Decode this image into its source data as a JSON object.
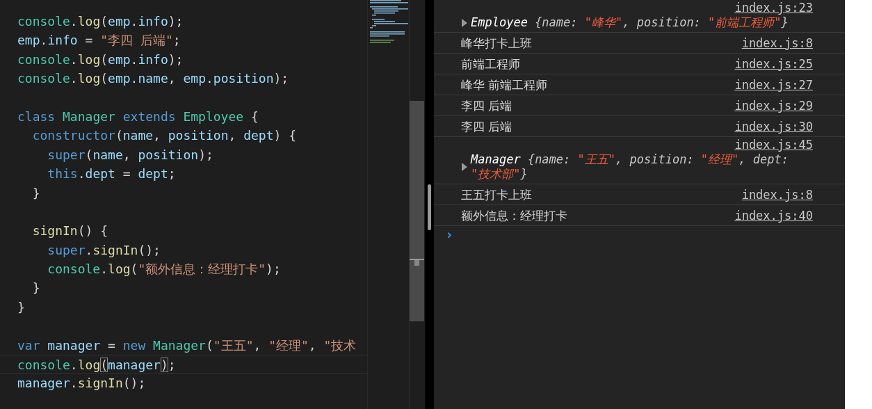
{
  "editor": {
    "lines": [
      {
        "kind": "code",
        "current": false,
        "tokens": [
          {
            "text": "console",
            "kind": "obj"
          },
          {
            "text": ".",
            "kind": "p"
          },
          {
            "text": "log",
            "kind": "fn"
          },
          {
            "text": "(",
            "kind": "p"
          },
          {
            "text": "emp",
            "kind": "var"
          },
          {
            "text": ".",
            "kind": "p"
          },
          {
            "text": "info",
            "kind": "var"
          },
          {
            "text": ");",
            "kind": "p"
          }
        ]
      },
      {
        "kind": "code",
        "current": false,
        "tokens": [
          {
            "text": "emp",
            "kind": "var"
          },
          {
            "text": ".",
            "kind": "p"
          },
          {
            "text": "info",
            "kind": "var"
          },
          {
            "text": " = ",
            "kind": "p"
          },
          {
            "text": "\"李四 后端\"",
            "kind": "str"
          },
          {
            "text": ";",
            "kind": "p"
          }
        ]
      },
      {
        "kind": "code",
        "current": false,
        "tokens": [
          {
            "text": "console",
            "kind": "obj"
          },
          {
            "text": ".",
            "kind": "p"
          },
          {
            "text": "log",
            "kind": "fn"
          },
          {
            "text": "(",
            "kind": "p"
          },
          {
            "text": "emp",
            "kind": "var"
          },
          {
            "text": ".",
            "kind": "p"
          },
          {
            "text": "info",
            "kind": "var"
          },
          {
            "text": ");",
            "kind": "p"
          }
        ]
      },
      {
        "kind": "code",
        "current": false,
        "tokens": [
          {
            "text": "console",
            "kind": "obj"
          },
          {
            "text": ".",
            "kind": "p"
          },
          {
            "text": "log",
            "kind": "fn"
          },
          {
            "text": "(",
            "kind": "p"
          },
          {
            "text": "emp",
            "kind": "var"
          },
          {
            "text": ".",
            "kind": "p"
          },
          {
            "text": "name",
            "kind": "var"
          },
          {
            "text": ", ",
            "kind": "p"
          },
          {
            "text": "emp",
            "kind": "var"
          },
          {
            "text": ".",
            "kind": "p"
          },
          {
            "text": "position",
            "kind": "var"
          },
          {
            "text": ");",
            "kind": "p"
          }
        ]
      },
      {
        "kind": "blank"
      },
      {
        "kind": "code",
        "current": false,
        "tokens": [
          {
            "text": "class ",
            "kind": "kw"
          },
          {
            "text": "Manager ",
            "kind": "obj"
          },
          {
            "text": "extends ",
            "kind": "kw"
          },
          {
            "text": "Employee",
            "kind": "obj"
          },
          {
            "text": " {",
            "kind": "p"
          }
        ]
      },
      {
        "kind": "code",
        "current": false,
        "tokens": [
          {
            "text": "  constructor",
            "kind": "kw"
          },
          {
            "text": "(",
            "kind": "p"
          },
          {
            "text": "name",
            "kind": "var"
          },
          {
            "text": ", ",
            "kind": "p"
          },
          {
            "text": "position",
            "kind": "var"
          },
          {
            "text": ", ",
            "kind": "p"
          },
          {
            "text": "dept",
            "kind": "var"
          },
          {
            "text": ") {",
            "kind": "p"
          }
        ]
      },
      {
        "kind": "code",
        "current": false,
        "tokens": [
          {
            "text": "    super",
            "kind": "kw"
          },
          {
            "text": "(",
            "kind": "p"
          },
          {
            "text": "name",
            "kind": "var"
          },
          {
            "text": ", ",
            "kind": "p"
          },
          {
            "text": "position",
            "kind": "var"
          },
          {
            "text": ");",
            "kind": "p"
          }
        ]
      },
      {
        "kind": "code",
        "current": false,
        "tokens": [
          {
            "text": "    this",
            "kind": "kw"
          },
          {
            "text": ".",
            "kind": "p"
          },
          {
            "text": "dept",
            "kind": "var"
          },
          {
            "text": " = ",
            "kind": "p"
          },
          {
            "text": "dept",
            "kind": "var"
          },
          {
            "text": ";",
            "kind": "p"
          }
        ]
      },
      {
        "kind": "code",
        "current": false,
        "tokens": [
          {
            "text": "  }",
            "kind": "p"
          }
        ]
      },
      {
        "kind": "blank"
      },
      {
        "kind": "code",
        "current": false,
        "tokens": [
          {
            "text": "  signIn",
            "kind": "fn"
          },
          {
            "text": "() {",
            "kind": "p"
          }
        ]
      },
      {
        "kind": "code",
        "current": false,
        "tokens": [
          {
            "text": "    super",
            "kind": "kw"
          },
          {
            "text": ".",
            "kind": "p"
          },
          {
            "text": "signIn",
            "kind": "fn"
          },
          {
            "text": "();",
            "kind": "p"
          }
        ]
      },
      {
        "kind": "code",
        "current": false,
        "tokens": [
          {
            "text": "    console",
            "kind": "obj"
          },
          {
            "text": ".",
            "kind": "p"
          },
          {
            "text": "log",
            "kind": "fn"
          },
          {
            "text": "(",
            "kind": "p"
          },
          {
            "text": "\"额外信息：经理打卡\"",
            "kind": "str"
          },
          {
            "text": ");",
            "kind": "p"
          }
        ]
      },
      {
        "kind": "code",
        "current": false,
        "tokens": [
          {
            "text": "  }",
            "kind": "p"
          }
        ]
      },
      {
        "kind": "code",
        "current": false,
        "tokens": [
          {
            "text": "}",
            "kind": "p"
          }
        ]
      },
      {
        "kind": "blank"
      },
      {
        "kind": "code",
        "current": false,
        "tokens": [
          {
            "text": "var ",
            "kind": "kw"
          },
          {
            "text": "manager",
            "kind": "var"
          },
          {
            "text": " = ",
            "kind": "p"
          },
          {
            "text": "new ",
            "kind": "kw"
          },
          {
            "text": "Manager",
            "kind": "obj"
          },
          {
            "text": "(",
            "kind": "p"
          },
          {
            "text": "\"王五\"",
            "kind": "str"
          },
          {
            "text": ", ",
            "kind": "p"
          },
          {
            "text": "\"经理\"",
            "kind": "str"
          },
          {
            "text": ", ",
            "kind": "p"
          },
          {
            "text": "\"技术",
            "kind": "str"
          }
        ]
      },
      {
        "kind": "code",
        "current": true,
        "tokens": [
          {
            "text": "console",
            "kind": "obj"
          },
          {
            "text": ".",
            "kind": "p"
          },
          {
            "text": "log",
            "kind": "fn"
          },
          {
            "text": "(",
            "kind": "match"
          },
          {
            "text": "manager",
            "kind": "var"
          },
          {
            "text": ")",
            "kind": "match"
          },
          {
            "text": ";",
            "kind": "p"
          }
        ]
      },
      {
        "kind": "code",
        "current": false,
        "tokens": [
          {
            "text": "manager",
            "kind": "var"
          },
          {
            "text": ".",
            "kind": "p"
          },
          {
            "text": "signIn",
            "kind": "fn"
          },
          {
            "text": "();",
            "kind": "p"
          }
        ]
      }
    ]
  },
  "console": {
    "messages": [
      {
        "kind": "object",
        "source": "index.js:23",
        "expanded": false,
        "preview": [
          {
            "text": "Employee",
            "kind": "cls"
          },
          {
            "text": " {name: ",
            "kind": "key"
          },
          {
            "text": "\"峰华\"",
            "kind": "str"
          },
          {
            "text": ", position: ",
            "kind": "key"
          },
          {
            "text": "\"前端工程师\"",
            "kind": "str"
          },
          {
            "text": "}",
            "kind": "key"
          }
        ]
      },
      {
        "kind": "text",
        "text": "峰华打卡上班",
        "source": "index.js:8"
      },
      {
        "kind": "text",
        "text": "前端工程师",
        "source": "index.js:25"
      },
      {
        "kind": "text",
        "text": "峰华 前端工程师",
        "source": "index.js:27"
      },
      {
        "kind": "text",
        "text": "李四 后端",
        "source": "index.js:29"
      },
      {
        "kind": "text",
        "text": "李四 后端",
        "source": "index.js:30"
      },
      {
        "kind": "object",
        "source": "index.js:45",
        "expanded": false,
        "preview": [
          {
            "text": "Manager",
            "kind": "cls"
          },
          {
            "text": " {name: ",
            "kind": "key"
          },
          {
            "text": "\"王五\"",
            "kind": "str"
          },
          {
            "text": ", position: ",
            "kind": "key"
          },
          {
            "text": "\"经理\"",
            "kind": "str"
          },
          {
            "text": ", dept: ",
            "kind": "key"
          },
          {
            "text": "\"技术部\"",
            "kind": "str"
          },
          {
            "text": "}",
            "kind": "key"
          }
        ]
      },
      {
        "kind": "text",
        "text": "王五打卡上班",
        "source": "index.js:8"
      },
      {
        "kind": "text",
        "text": "额外信息：经理打卡",
        "source": "index.js:40"
      }
    ],
    "prompt": "›"
  }
}
